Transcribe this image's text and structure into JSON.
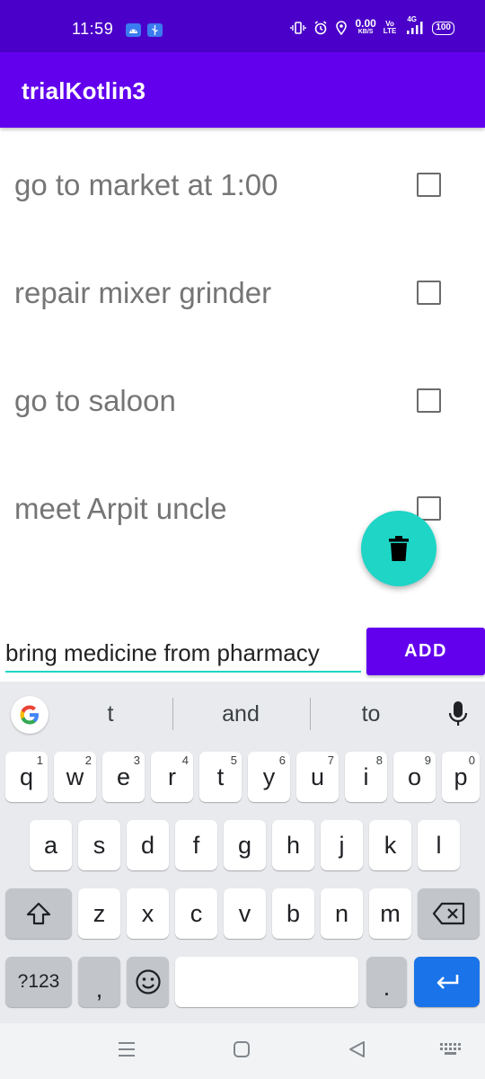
{
  "status_bar": {
    "time": "11:59",
    "net_speed_value": "0.00",
    "net_speed_unit": "KB/S",
    "volte_top": "Vo",
    "volte_bottom": "LTE",
    "network_type": "4G",
    "battery": "100",
    "colors": {
      "background": "#4a00c8"
    }
  },
  "app_bar": {
    "title": "trialKotlin3",
    "colors": {
      "background": "#6200ee"
    }
  },
  "todo_list": {
    "items": [
      {
        "text": "go to market at 1:00",
        "checked": false
      },
      {
        "text": "repair mixer grinder",
        "checked": false
      },
      {
        "text": "go to saloon",
        "checked": false
      },
      {
        "text": "meet Arpit uncle",
        "checked": false
      }
    ]
  },
  "fab": {
    "icon": "trash-icon",
    "color": "#1ed5c6"
  },
  "input_row": {
    "task_value": "bring medicine from pharmacy",
    "add_label": "ADD"
  },
  "keyboard": {
    "suggestions": [
      "t",
      "and",
      "to"
    ],
    "row1": [
      {
        "key": "q",
        "hint": "1"
      },
      {
        "key": "w",
        "hint": "2"
      },
      {
        "key": "e",
        "hint": "3"
      },
      {
        "key": "r",
        "hint": "4"
      },
      {
        "key": "t",
        "hint": "5"
      },
      {
        "key": "y",
        "hint": "6"
      },
      {
        "key": "u",
        "hint": "7"
      },
      {
        "key": "i",
        "hint": "8"
      },
      {
        "key": "o",
        "hint": "9"
      },
      {
        "key": "p",
        "hint": "0"
      }
    ],
    "row2": [
      "a",
      "s",
      "d",
      "f",
      "g",
      "h",
      "j",
      "k",
      "l"
    ],
    "row3": [
      "z",
      "x",
      "c",
      "v",
      "b",
      "n",
      "m"
    ],
    "symbols_label": "?123",
    "comma_label": ",",
    "period_label": ".",
    "colors": {
      "enter": "#1a73e8",
      "background": "#e8eaed"
    }
  }
}
